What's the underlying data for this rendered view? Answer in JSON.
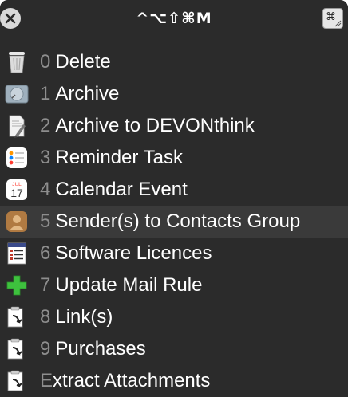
{
  "title": "^⌥⇧⌘M",
  "controls": {
    "cmd_glyph": "⌘"
  },
  "items": [
    {
      "num": "0",
      "label": "Delete",
      "icon": "trash-icon"
    },
    {
      "num": "1",
      "label": "Archive",
      "icon": "archive-box-icon"
    },
    {
      "num": "2",
      "label": "Archive to DEVONthink",
      "icon": "script-document-icon"
    },
    {
      "num": "3",
      "label": "Reminder Task",
      "icon": "reminders-list-icon"
    },
    {
      "num": "4",
      "label": "Calendar Event",
      "icon": "calendar-icon",
      "calendar_month": "JUL",
      "calendar_day": "17"
    },
    {
      "num": "5",
      "label": "Sender(s) to Contacts Group",
      "icon": "contacts-icon"
    },
    {
      "num": "6",
      "label": "Software Licences",
      "icon": "list-document-icon"
    },
    {
      "num": "7",
      "label": "Update Mail Rule",
      "icon": "green-plus-icon"
    },
    {
      "num": "8",
      "label": "Link(s)",
      "icon": "clipboard-arrow-icon"
    },
    {
      "num": "9",
      "label": "Purchases",
      "icon": "clipboard-arrow-icon"
    },
    {
      "num": "",
      "label_first": "E",
      "label_rest": "xtract Attachments",
      "icon": "clipboard-arrow-icon"
    }
  ],
  "selected_index": 5,
  "colors": {
    "panel_bg": "#2b2b2b",
    "selected_bg": "#3a3a3a",
    "number_gray": "#8e8e8e",
    "label_white": "#ffffff",
    "plus_green": "#3ec13e"
  }
}
